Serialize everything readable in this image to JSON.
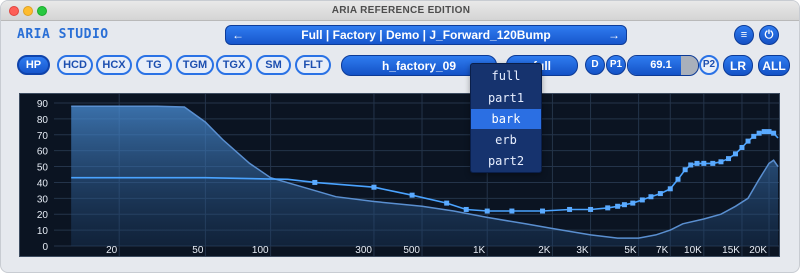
{
  "window": {
    "title": "ARIA REFERENCE EDITION"
  },
  "brand": "ARIA STUDIO",
  "preset": {
    "name": "Full | Factory | Demo | J_Forward_120Bump",
    "prev": "←",
    "next": "→"
  },
  "header_buttons": {
    "menu": "≡",
    "power": "⏻"
  },
  "filter_tabs": [
    {
      "label": "HP",
      "active": true
    },
    {
      "label": "HCD",
      "active": false
    },
    {
      "label": "HCX",
      "active": false
    },
    {
      "label": "TG",
      "active": false
    },
    {
      "label": "TGM",
      "active": false
    },
    {
      "label": "TGX",
      "active": false
    },
    {
      "label": "SM",
      "active": false
    },
    {
      "label": "FLT",
      "active": false
    }
  ],
  "ir_name": "h_factory_09",
  "mode_field": "full",
  "d_button": "D",
  "p1_button": "P1",
  "gain": {
    "value": "69.1",
    "fill_fraction": 0.75
  },
  "p2_button": "P2",
  "lr_button": "LR",
  "all_button": "ALL",
  "dropdown": {
    "options": [
      "full",
      "part1",
      "bark",
      "erb",
      "part2"
    ],
    "selected_index": 2
  },
  "colors": {
    "accent": "#2a72e5",
    "accent_dark": "#1756cc",
    "graph_bg": "#0b1422",
    "curve": "#4aa3ff"
  },
  "chart_data": {
    "type": "line",
    "title": "",
    "xlabel": "",
    "ylabel": "",
    "x_scale": "log",
    "xlim": [
      10,
      22000
    ],
    "ylim": [
      0,
      90
    ],
    "grid": true,
    "x_ticks": [
      {
        "value": 20,
        "label": "20"
      },
      {
        "value": 50,
        "label": "50"
      },
      {
        "value": 100,
        "label": "100"
      },
      {
        "value": 300,
        "label": "300"
      },
      {
        "value": 500,
        "label": "500"
      },
      {
        "value": 1000,
        "label": "1K"
      },
      {
        "value": 2000,
        "label": "2K"
      },
      {
        "value": 3000,
        "label": "3K"
      },
      {
        "value": 5000,
        "label": "5K"
      },
      {
        "value": 7000,
        "label": "7K"
      },
      {
        "value": 10000,
        "label": "10K"
      },
      {
        "value": 15000,
        "label": "15K"
      },
      {
        "value": 20000,
        "label": "20K"
      }
    ],
    "y_ticks": [
      {
        "value": 90,
        "label": "90"
      },
      {
        "value": 80,
        "label": "80"
      },
      {
        "value": 70,
        "label": "70"
      },
      {
        "value": 60,
        "label": "60"
      },
      {
        "value": 50,
        "label": "50"
      },
      {
        "value": 40,
        "label": "40"
      },
      {
        "value": 30,
        "label": "30"
      },
      {
        "value": 20,
        "label": "20"
      },
      {
        "value": 10,
        "label": "10"
      },
      {
        "value": 0,
        "label": "0"
      }
    ],
    "series": [
      {
        "style": "area",
        "values": [
          {
            "x": 12,
            "y": 88
          },
          {
            "x": 20,
            "y": 88
          },
          {
            "x": 30,
            "y": 88
          },
          {
            "x": 40,
            "y": 87.5
          },
          {
            "x": 50,
            "y": 78
          },
          {
            "x": 60,
            "y": 67
          },
          {
            "x": 80,
            "y": 52
          },
          {
            "x": 100,
            "y": 43
          },
          {
            "x": 150,
            "y": 36
          },
          {
            "x": 200,
            "y": 31
          },
          {
            "x": 300,
            "y": 28
          },
          {
            "x": 500,
            "y": 25
          },
          {
            "x": 700,
            "y": 22
          },
          {
            "x": 1000,
            "y": 18
          },
          {
            "x": 1500,
            "y": 14
          },
          {
            "x": 2000,
            "y": 11
          },
          {
            "x": 3000,
            "y": 7
          },
          {
            "x": 4000,
            "y": 5
          },
          {
            "x": 5000,
            "y": 5
          },
          {
            "x": 6000,
            "y": 7
          },
          {
            "x": 7000,
            "y": 10
          },
          {
            "x": 8000,
            "y": 14
          },
          {
            "x": 10000,
            "y": 17
          },
          {
            "x": 12000,
            "y": 20
          },
          {
            "x": 14000,
            "y": 25
          },
          {
            "x": 16000,
            "y": 30
          },
          {
            "x": 18000,
            "y": 42
          },
          {
            "x": 20000,
            "y": 52
          },
          {
            "x": 21000,
            "y": 54
          },
          {
            "x": 22000,
            "y": 50
          }
        ]
      },
      {
        "style": "line-markers",
        "values": [
          {
            "x": 12,
            "y": 43
          },
          {
            "x": 50,
            "y": 43
          },
          {
            "x": 120,
            "y": 42
          },
          {
            "x": 160,
            "y": 40
          },
          {
            "x": 300,
            "y": 37
          },
          {
            "x": 450,
            "y": 32
          },
          {
            "x": 650,
            "y": 27
          },
          {
            "x": 800,
            "y": 23
          },
          {
            "x": 1000,
            "y": 22
          },
          {
            "x": 1300,
            "y": 22
          },
          {
            "x": 1800,
            "y": 22
          },
          {
            "x": 2400,
            "y": 23
          },
          {
            "x": 3000,
            "y": 23
          },
          {
            "x": 3600,
            "y": 24
          },
          {
            "x": 4000,
            "y": 25
          },
          {
            "x": 4300,
            "y": 26
          },
          {
            "x": 4700,
            "y": 27
          },
          {
            "x": 5200,
            "y": 29
          },
          {
            "x": 5700,
            "y": 31
          },
          {
            "x": 6300,
            "y": 33
          },
          {
            "x": 7000,
            "y": 36
          },
          {
            "x": 7600,
            "y": 42
          },
          {
            "x": 8200,
            "y": 48
          },
          {
            "x": 8700,
            "y": 51
          },
          {
            "x": 9300,
            "y": 52
          },
          {
            "x": 10000,
            "y": 52
          },
          {
            "x": 11000,
            "y": 52
          },
          {
            "x": 12000,
            "y": 53
          },
          {
            "x": 13000,
            "y": 55
          },
          {
            "x": 14000,
            "y": 58
          },
          {
            "x": 15000,
            "y": 62
          },
          {
            "x": 16000,
            "y": 66
          },
          {
            "x": 17000,
            "y": 69
          },
          {
            "x": 18000,
            "y": 71
          },
          {
            "x": 19000,
            "y": 72
          },
          {
            "x": 20000,
            "y": 72
          },
          {
            "x": 21000,
            "y": 71
          },
          {
            "x": 22000,
            "y": 68
          }
        ]
      }
    ]
  }
}
